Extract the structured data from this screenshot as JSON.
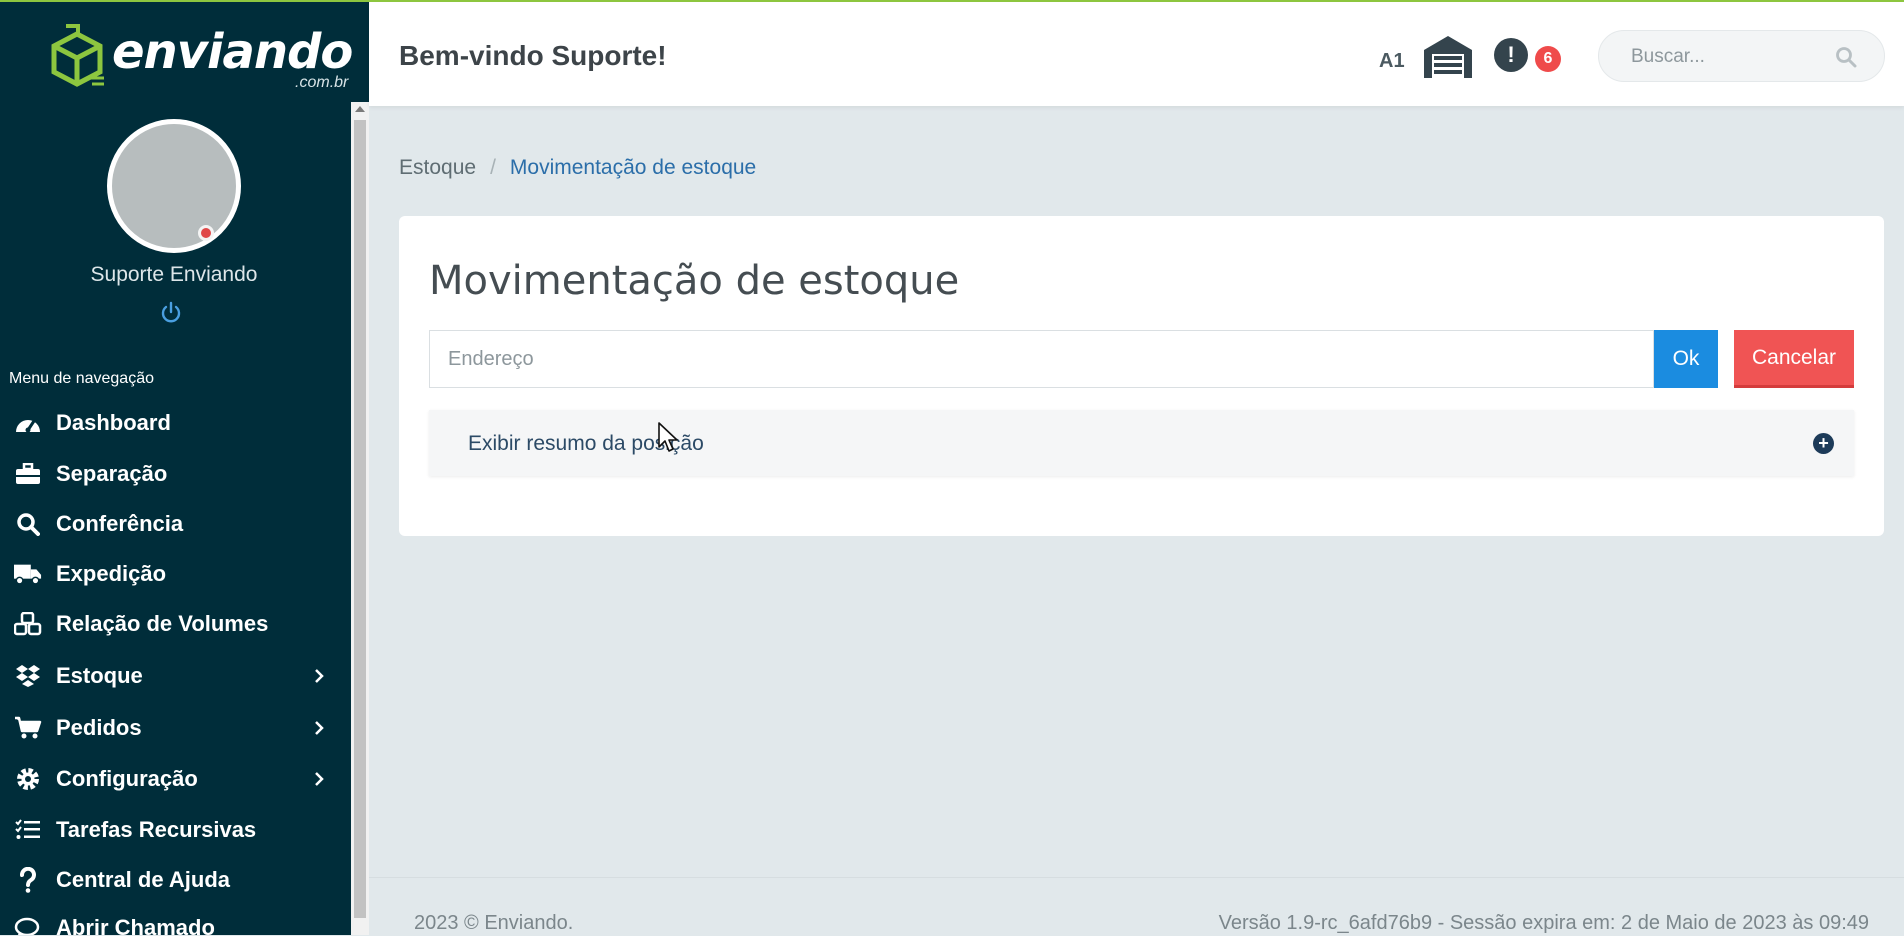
{
  "brand": {
    "name": "enviando",
    "domain": ".com.br",
    "accent": "#8dc63f"
  },
  "sidebar": {
    "user_name": "Suporte Enviando",
    "nav_heading": "Menu de navegação",
    "items": [
      {
        "label": "Dashboard",
        "icon": "dashboard-icon"
      },
      {
        "label": "Separação",
        "icon": "briefcase-icon"
      },
      {
        "label": "Conferência",
        "icon": "search-icon"
      },
      {
        "label": "Expedição",
        "icon": "truck-icon"
      },
      {
        "label": "Relação de Volumes",
        "icon": "boxes-icon"
      },
      {
        "label": "Estoque",
        "icon": "dropbox-icon",
        "expandable": true
      },
      {
        "label": "Pedidos",
        "icon": "cart-icon",
        "expandable": true
      },
      {
        "label": "Configuração",
        "icon": "gear-icon",
        "expandable": true
      },
      {
        "label": "Tarefas Recursivas",
        "icon": "task-list-icon"
      },
      {
        "label": "Central de Ajuda",
        "icon": "question-icon"
      },
      {
        "label": "Abrir Chamado",
        "icon": "chat-icon"
      }
    ]
  },
  "header": {
    "welcome": "Bem-vindo Suporte!",
    "warehouse_code": "A1",
    "notification_count": "6",
    "alert_symbol": "!",
    "search_placeholder": "Buscar..."
  },
  "breadcrumb": {
    "parent": "Estoque",
    "separator": "/",
    "current": "Movimentação de estoque"
  },
  "main": {
    "title": "Movimentação de estoque",
    "address_placeholder": "Endereço",
    "ok_label": "Ok",
    "cancel_label": "Cancelar",
    "summary_toggle": "Exibir resumo da posição",
    "summary_toggle_symbol": "+"
  },
  "footer": {
    "copyright": "2023 © Enviando.",
    "version": "Versão 1.9-rc_6afd76b9 - Sessão expira em: 2 de Maio de 2023 às 09:49"
  }
}
